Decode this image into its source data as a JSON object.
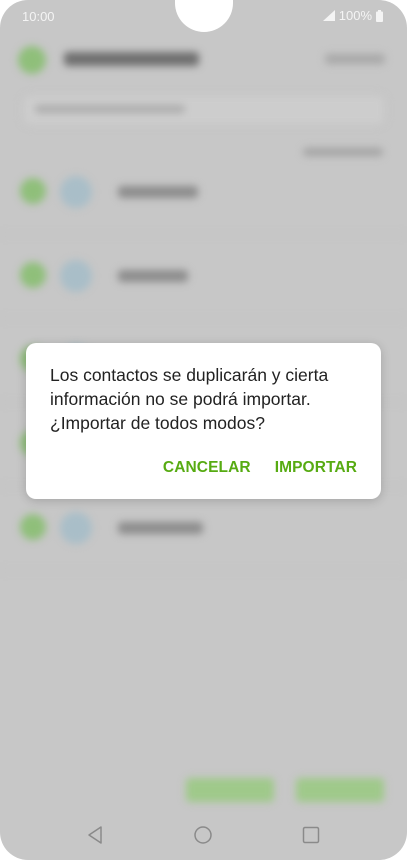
{
  "status_bar": {
    "time": "10:00",
    "battery": "100%",
    "icons": [
      "signal-icon",
      "battery-icon"
    ]
  },
  "dialog": {
    "message": "Los contactos se duplicarán y cierta\ninformación no se podrá importar.\n¿Importar de todos modos?",
    "cancel_label": "CANCELAR",
    "import_label": "IMPORTAR",
    "accent_color": "#57ab12"
  },
  "nav_bar": {
    "icons": [
      "back-icon",
      "home-icon",
      "recents-icon"
    ]
  },
  "colors": {
    "scrim": "#c7c7c7",
    "accent": "#57ab12"
  }
}
